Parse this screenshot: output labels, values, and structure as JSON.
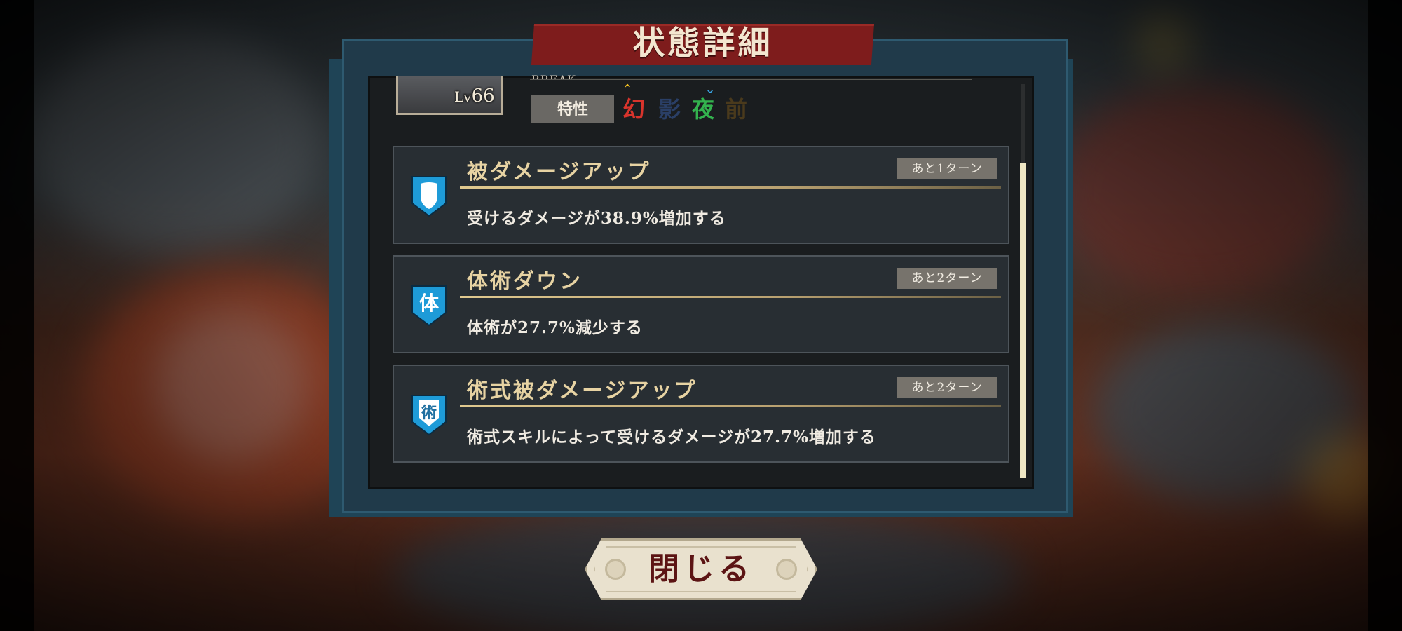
{
  "dialog": {
    "title": "状態詳細",
    "close_label": "閉じる"
  },
  "character": {
    "level_prefix": "Lv",
    "level": "66",
    "name_partial": "BREAK",
    "trait_label": "特性",
    "traits": [
      {
        "glyph": "幻",
        "color": "#d8342c",
        "modifier": "up"
      },
      {
        "glyph": "影",
        "color": "#2a3f66",
        "modifier": ""
      },
      {
        "glyph": "夜",
        "color": "#33b34e",
        "modifier": "down"
      },
      {
        "glyph": "前",
        "color": "#4a3a1c",
        "modifier": ""
      }
    ]
  },
  "statuses": [
    {
      "icon": "shield-icon",
      "icon_glyph": "",
      "title": "被ダメージアップ",
      "turns": "あと1ターン",
      "description": "受けるダメージが38.9%増加する"
    },
    {
      "icon": "body-art-icon",
      "icon_glyph": "体",
      "title": "体術ダウン",
      "turns": "あと2ターン",
      "description": "体術が27.7%減少する"
    },
    {
      "icon": "technique-icon",
      "icon_glyph": "術",
      "title": "術式被ダメージアップ",
      "turns": "あと2ターン",
      "description": "術式スキルによって受けるダメージが27.7%増加する"
    }
  ],
  "colors": {
    "accent_gold": "#e7d3a3",
    "banner_red": "#7e1c1c",
    "icon_blue": "#1e9bd8",
    "close_text": "#5c1414"
  }
}
